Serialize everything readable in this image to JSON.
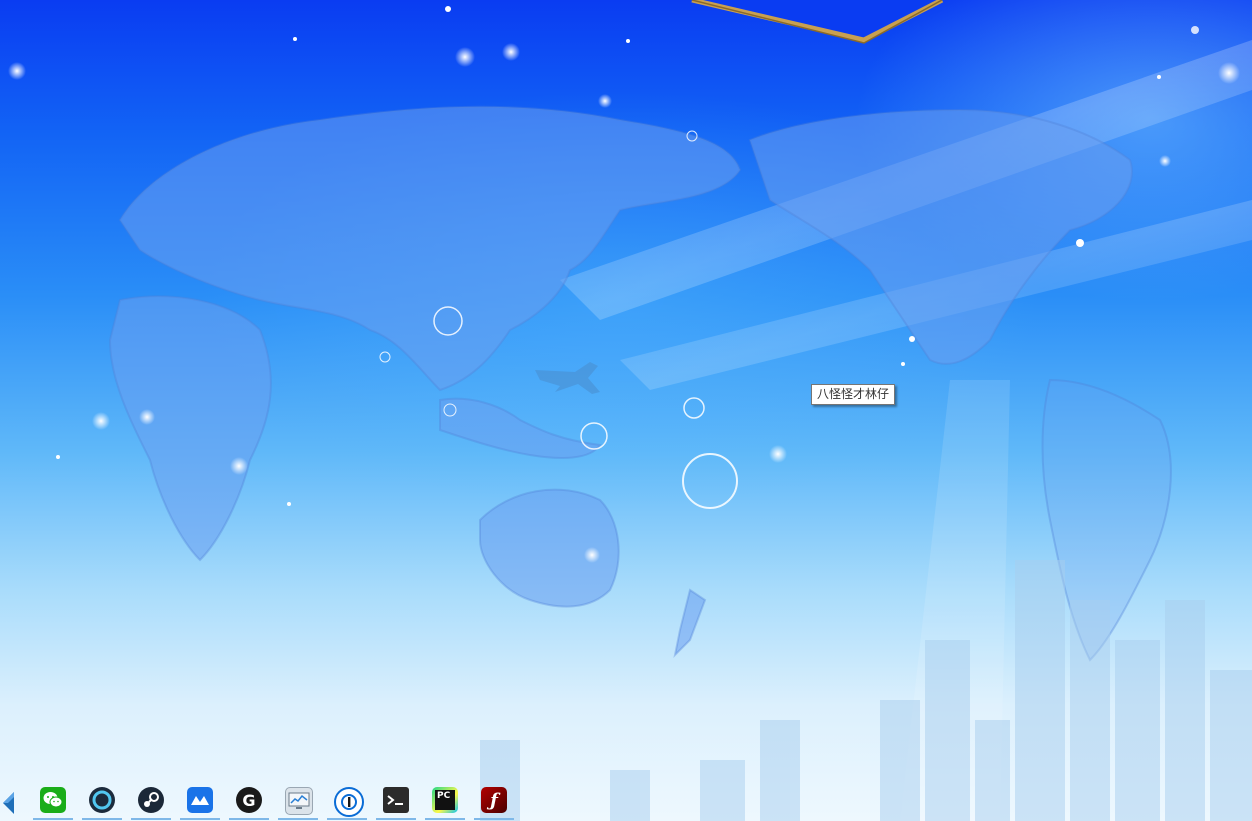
{
  "tooltip": {
    "text": "八怪怪才林仔"
  },
  "taskbar": {
    "items": [
      {
        "name": "wechat",
        "icon": "wechat-icon",
        "color": "#1aad19"
      },
      {
        "name": "app-ring",
        "icon": "ring-icon",
        "color": "#1c2b3c"
      },
      {
        "name": "steam",
        "icon": "steam-icon",
        "color": "#1b2838"
      },
      {
        "name": "app-blue",
        "icon": "blue-app-icon",
        "color": "#1a73e8"
      },
      {
        "name": "app-g",
        "icon": "g-logo-icon",
        "color": "#1a1a1a"
      },
      {
        "name": "resource-monitor",
        "icon": "monitor-icon",
        "color": "#c9d3dd"
      },
      {
        "name": "1password",
        "icon": "key-icon",
        "color": "#0a6cd6"
      },
      {
        "name": "terminal",
        "icon": "terminal-icon",
        "color": "#2b2b2b"
      },
      {
        "name": "pycharm",
        "icon": "pycharm-icon",
        "color": "#111111"
      },
      {
        "name": "flash",
        "icon": "flash-icon",
        "color": "#8b0000"
      }
    ],
    "glyphs": {
      "pycharm": "PC",
      "flash": "ƒ",
      "g": "G"
    }
  }
}
